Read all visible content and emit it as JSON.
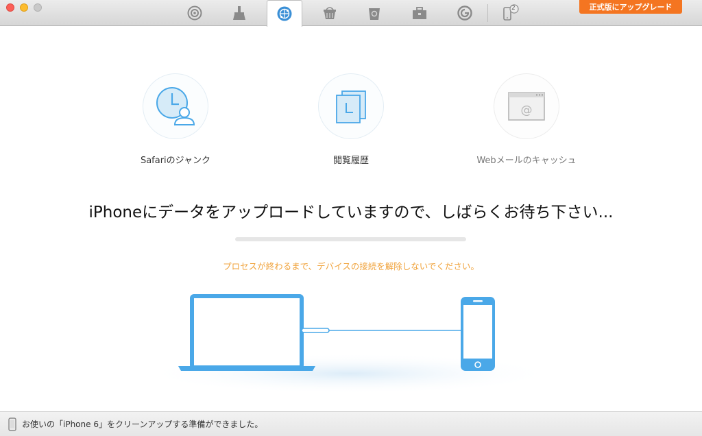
{
  "toolbar": {
    "items": [
      {
        "icon": "overview-icon"
      },
      {
        "icon": "clean-broom-icon"
      },
      {
        "icon": "internet-globe-icon",
        "active": true
      },
      {
        "icon": "junk-basket-icon"
      },
      {
        "icon": "trash-bin-icon"
      },
      {
        "icon": "toolbox-icon"
      },
      {
        "icon": "refresh-icon"
      },
      {
        "icon": "device-icon",
        "badge": "2"
      }
    ],
    "upgrade_label": "正式版にアップグレード",
    "accent": "#f47521"
  },
  "categories": [
    {
      "label": "Safariのジャンク",
      "icon": "clock-user-icon"
    },
    {
      "label": "閲覧履歴",
      "icon": "history-pages-icon"
    },
    {
      "label": "Webメールのキャッシュ",
      "icon": "webmail-at-icon"
    }
  ],
  "main": {
    "headline": "iPhoneにデータをアップロードしていますので、しばらくお待ち下さい...",
    "progress": 0.0,
    "warning": "プロセスが終わるまで、デバイスの接続を解除しないでください。",
    "warning_color": "#f0a23a"
  },
  "statusbar": {
    "text": "お使いの「iPhone 6」をクリーンアップする準備ができました。",
    "icon": "phone-icon"
  },
  "colors": {
    "illustration_blue": "#4aa8e8"
  }
}
